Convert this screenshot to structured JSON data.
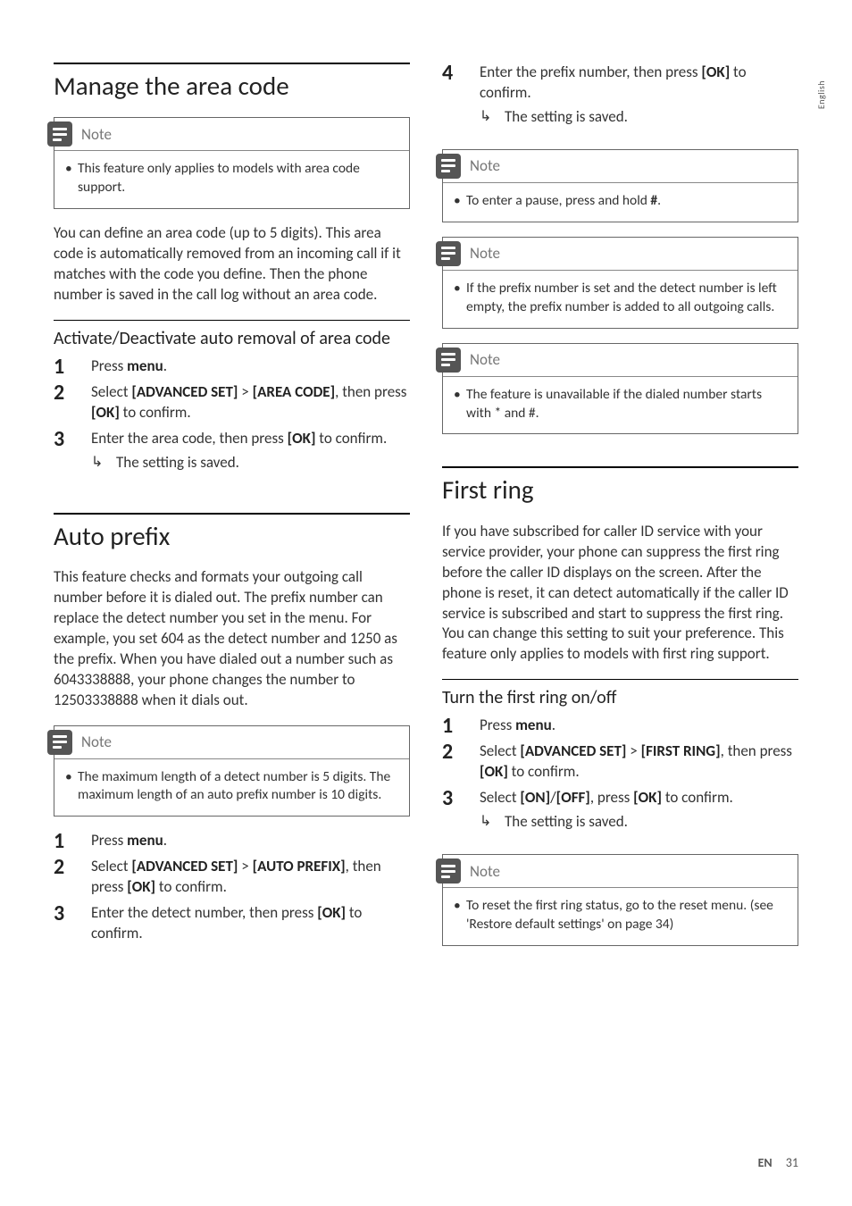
{
  "side_tab": "English",
  "left": {
    "h1_area": "Manage the area code",
    "note_area": {
      "label": "Note",
      "text": "This feature only applies to models with area code support."
    },
    "area_body": "You can define an area code (up to 5 digits). This area code is automatically removed from an incoming call if it matches with the code you define. Then the phone number is saved in the call log without an area code.",
    "h2_area": "Activate/Deactivate auto removal of area code",
    "area_steps": {
      "s1a": "Press ",
      "s1b": "menu",
      "s1c": ".",
      "s2a": "Select ",
      "s2b": "[ADVANCED SET]",
      "s2c": " > ",
      "s2d": "[AREA CODE]",
      "s2e": ", then press ",
      "s2f": "[OK]",
      "s2g": " to confirm.",
      "s3a": "Enter the area code, then press ",
      "s3b": "[OK]",
      "s3c": " to confirm.",
      "s3r": "The setting is saved."
    },
    "h1_prefix": "Auto prefix",
    "prefix_body": "This feature checks and formats your outgoing call number before it is dialed out. The prefix number can replace the detect number you set in the menu. For example, you set 604 as the detect number and 1250 as the prefix. When you have dialed out a number such as 6043338888, your phone changes the number to 12503338888 when it dials out.",
    "note_prefix": {
      "label": "Note",
      "text": "The maximum length of a detect number is 5 digits. The maximum length of an auto prefix number is 10 digits."
    },
    "prefix_steps": {
      "s1a": "Press ",
      "s1b": "menu",
      "s1c": ".",
      "s2a": "Select ",
      "s2b": "[ADVANCED SET]",
      "s2c": " > ",
      "s2d": "[AUTO PREFIX]",
      "s2e": ", then press ",
      "s2f": "[OK]",
      "s2g": " to confirm.",
      "s3a": "Enter the detect number, then press ",
      "s3b": "[OK]",
      "s3c": " to confirm."
    }
  },
  "right": {
    "cont_steps": {
      "s4a": "Enter the prefix number, then press ",
      "s4b": "[OK]",
      "s4c": " to confirm.",
      "s4r": "The setting is saved."
    },
    "note_pause": {
      "label": "Note",
      "text_a": "To enter a pause, press and hold ",
      "text_b": "."
    },
    "note_empty": {
      "label": "Note",
      "text": "If the prefix number is set and the detect number is left empty, the prefix number is added to all outgoing calls."
    },
    "note_unavail": {
      "label": "Note",
      "text": "The feature is unavailable if the dialed number starts with * and #."
    },
    "h1_ring": "First ring",
    "ring_body": "If you have subscribed for caller ID service with your service provider, your phone can suppress the first ring before the caller ID displays on the screen. After the phone is reset, it can detect automatically if the caller ID service is subscribed and start to suppress the first ring. You can change this setting to suit your preference. This feature only applies to models with first ring support.",
    "h2_ring": "Turn the first ring on/off",
    "ring_steps": {
      "s1a": "Press ",
      "s1b": "menu",
      "s1c": ".",
      "s2a": "Select ",
      "s2b": "[ADVANCED SET]",
      "s2c": " > ",
      "s2d": "[FIRST RING]",
      "s2e": ", then press ",
      "s2f": "[OK]",
      "s2g": " to confirm.",
      "s3a": "Select ",
      "s3b": "[ON]",
      "s3c": "/",
      "s3d": "[OFF]",
      "s3e": ", press ",
      "s3f": "[OK]",
      "s3g": " to confirm.",
      "s3r": "The setting is saved."
    },
    "note_reset": {
      "label": "Note",
      "text": "To reset the first ring status, go to the reset menu. (see 'Restore default settings' on page 34)"
    }
  },
  "footer": {
    "lang": "EN",
    "page": "31"
  }
}
